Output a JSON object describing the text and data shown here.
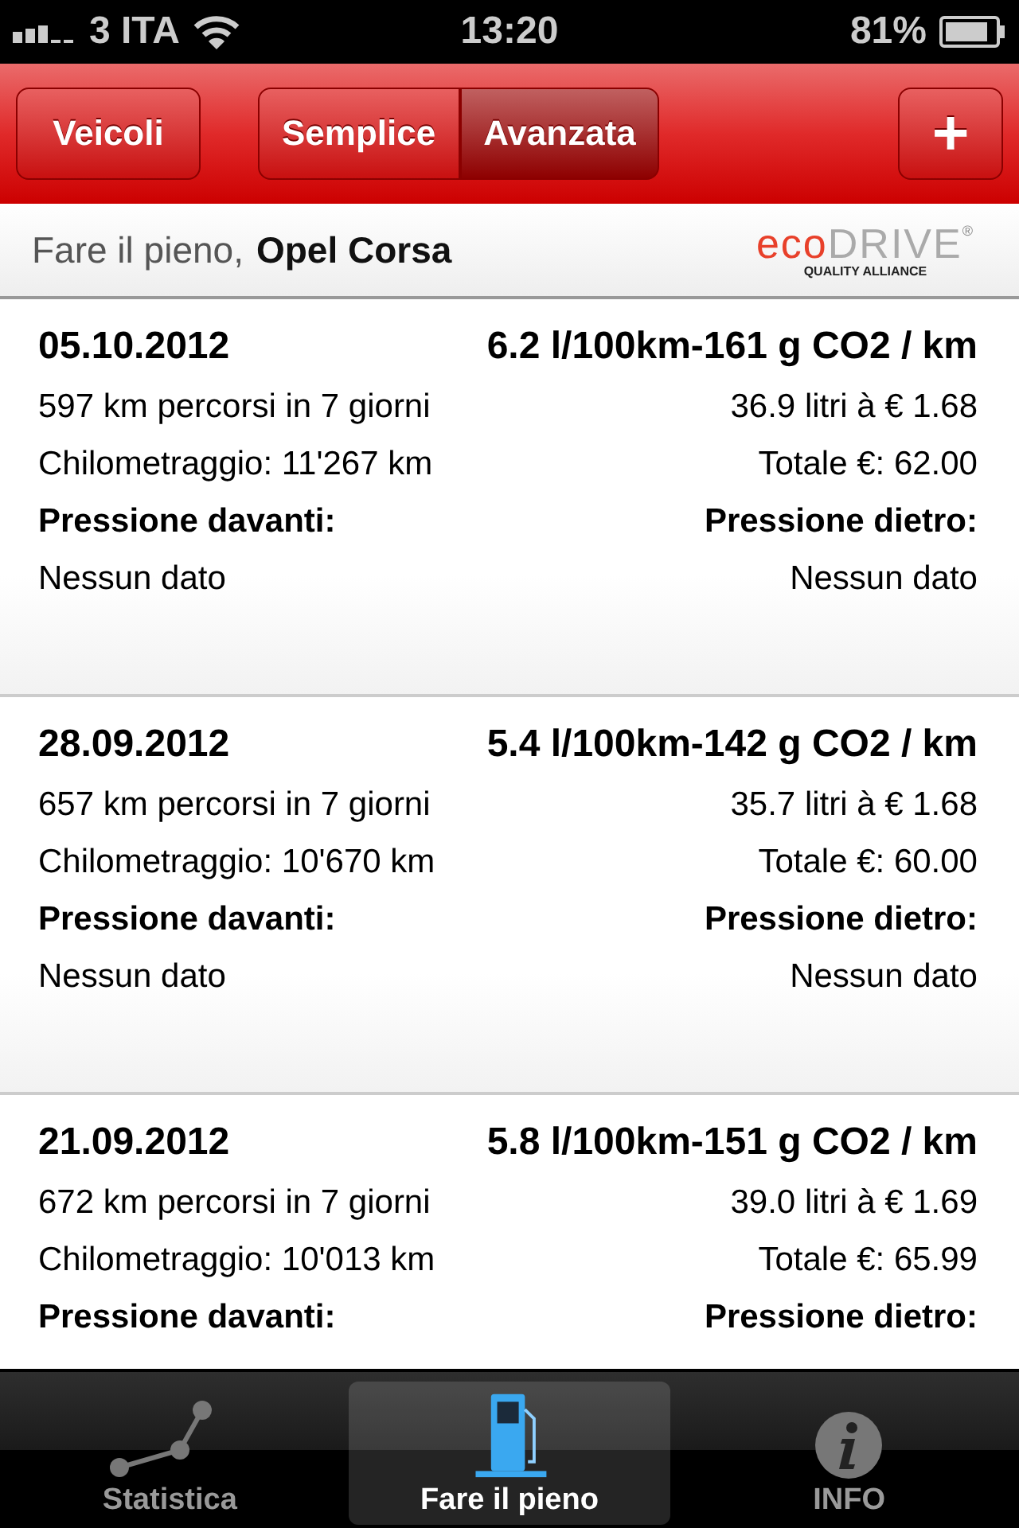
{
  "status_bar": {
    "carrier": "3 ITA",
    "time": "13:20",
    "battery": "81%"
  },
  "nav_bar": {
    "left_button": "Veicoli",
    "segments": [
      {
        "label": "Semplice",
        "selected": false
      },
      {
        "label": "Avanzata",
        "selected": true
      }
    ],
    "add_button": "+"
  },
  "header": {
    "title": "Fare il pieno,",
    "vehicle": "Opel Corsa",
    "logo": {
      "part_1": "eco",
      "part_2": "DRIVE",
      "mark": "®",
      "tagline": "QUALITY ALLIANCE"
    }
  },
  "entries": [
    {
      "date": "05.10.2012",
      "consumption": "6.2 l/100km-161 g CO2 / km",
      "distance": "597 km percorsi in 7 giorni",
      "fuel": "36.9 litri à € 1.68",
      "odometer": "Chilometraggio: 11'267 km",
      "total": "Totale €: 62.00",
      "front_label": "Pressione davanti:",
      "rear_label": "Pressione dietro:",
      "front_value": "Nessun dato",
      "rear_value": "Nessun dato"
    },
    {
      "date": "28.09.2012",
      "consumption": "5.4 l/100km-142 g CO2 / km",
      "distance": "657 km percorsi in 7 giorni",
      "fuel": "35.7 litri à € 1.68",
      "odometer": "Chilometraggio: 10'670 km",
      "total": "Totale €: 60.00",
      "front_label": "Pressione davanti:",
      "rear_label": "Pressione dietro:",
      "front_value": "Nessun dato",
      "rear_value": "Nessun dato"
    },
    {
      "date": "21.09.2012",
      "consumption": "5.8 l/100km-151 g CO2 / km",
      "distance": "672 km percorsi in 7 giorni",
      "fuel": "39.0 litri à € 1.69",
      "odometer": "Chilometraggio: 10'013 km",
      "total": "Totale €: 65.99",
      "front_label": "Pressione davanti:",
      "rear_label": "Pressione dietro:"
    }
  ],
  "tab_bar": [
    {
      "kind": "chart",
      "label": "Statistica",
      "selected": false
    },
    {
      "kind": "pump",
      "label": "Fare il pieno",
      "selected": true
    },
    {
      "kind": "info",
      "label": "INFO",
      "selected": false
    }
  ]
}
